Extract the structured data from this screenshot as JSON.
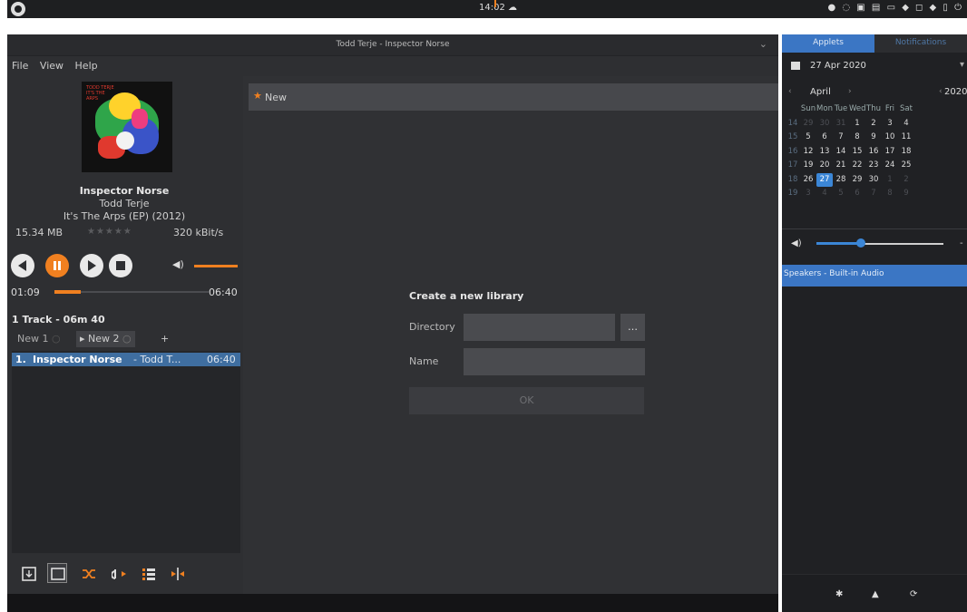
{
  "top_panel": {
    "clock": "14:02",
    "menu_icon": "menu-logo-icon",
    "tray": "● ◌ ▣ ▤ ▭ ◆ ◻ ◆ ▯ ⏻"
  },
  "window": {
    "title": "Todd Terje - Inspector Norse",
    "minimize": "⌄"
  },
  "menu": {
    "file": "File",
    "view": "View",
    "help": "Help"
  },
  "album": {
    "cover_text": "TODD TERJE\nIT'S THE\nARPS"
  },
  "now_playing": {
    "title": "Inspector Norse",
    "artist": "Todd Terje",
    "album": "It's The Arps (EP) (2012)",
    "file_size": "15.34 MB",
    "rating": "★★★★★",
    "bitrate": "320 kBit/s",
    "volume_fraction": 0.85
  },
  "time": {
    "current": "01:09",
    "total": "06:40",
    "progress_fraction": 0.17
  },
  "playlist_info": {
    "summary": "1 Track - 06m 40"
  },
  "tabs": [
    {
      "label": "New 1"
    },
    {
      "label": "New 2"
    }
  ],
  "tab_add": "+",
  "playlist": [
    {
      "num": "1.",
      "title": "Inspector Norse",
      "artist": "- Todd T...",
      "duration": "06:40"
    }
  ],
  "library": {
    "new_label": "New",
    "create_title": "Create a new library",
    "directory_label": "Directory",
    "name_label": "Name",
    "browse_label": "…",
    "ok_label": "OK"
  },
  "sidebar": {
    "tab_applets": "Applets",
    "tab_notifications": "Notifications",
    "date": "27 Apr 2020",
    "dropdown": "▾",
    "month": "April",
    "year": "2020",
    "month_prev": "‹",
    "month_next": "›",
    "year_prev": "‹",
    "weekday_headers": [
      "Sun",
      "Mon",
      "Tue",
      "Wed",
      "Thu",
      "Fri",
      "Sat"
    ],
    "weeks": [
      {
        "wk": "14",
        "days": [
          "29",
          "30",
          "31",
          "1",
          "2",
          "3",
          "4"
        ]
      },
      {
        "wk": "15",
        "days": [
          "5",
          "6",
          "7",
          "8",
          "9",
          "10",
          "11"
        ]
      },
      {
        "wk": "16",
        "days": [
          "12",
          "13",
          "14",
          "15",
          "16",
          "17",
          "18"
        ]
      },
      {
        "wk": "17",
        "days": [
          "19",
          "20",
          "21",
          "22",
          "23",
          "24",
          "25"
        ]
      },
      {
        "wk": "18",
        "days": [
          "26",
          "27",
          "28",
          "29",
          "30",
          "1",
          "2"
        ]
      },
      {
        "wk": "19",
        "days": [
          "3",
          "4",
          "5",
          "6",
          "7",
          "8",
          "9"
        ]
      }
    ],
    "today": "27",
    "volume_fraction": 0.35,
    "volume_end": "-",
    "speaker": "Speakers - Built-in Audio",
    "accent": "#3b76c4"
  },
  "colors": {
    "accent_orange": "#f08020",
    "selection_blue": "#3f6ea0"
  }
}
